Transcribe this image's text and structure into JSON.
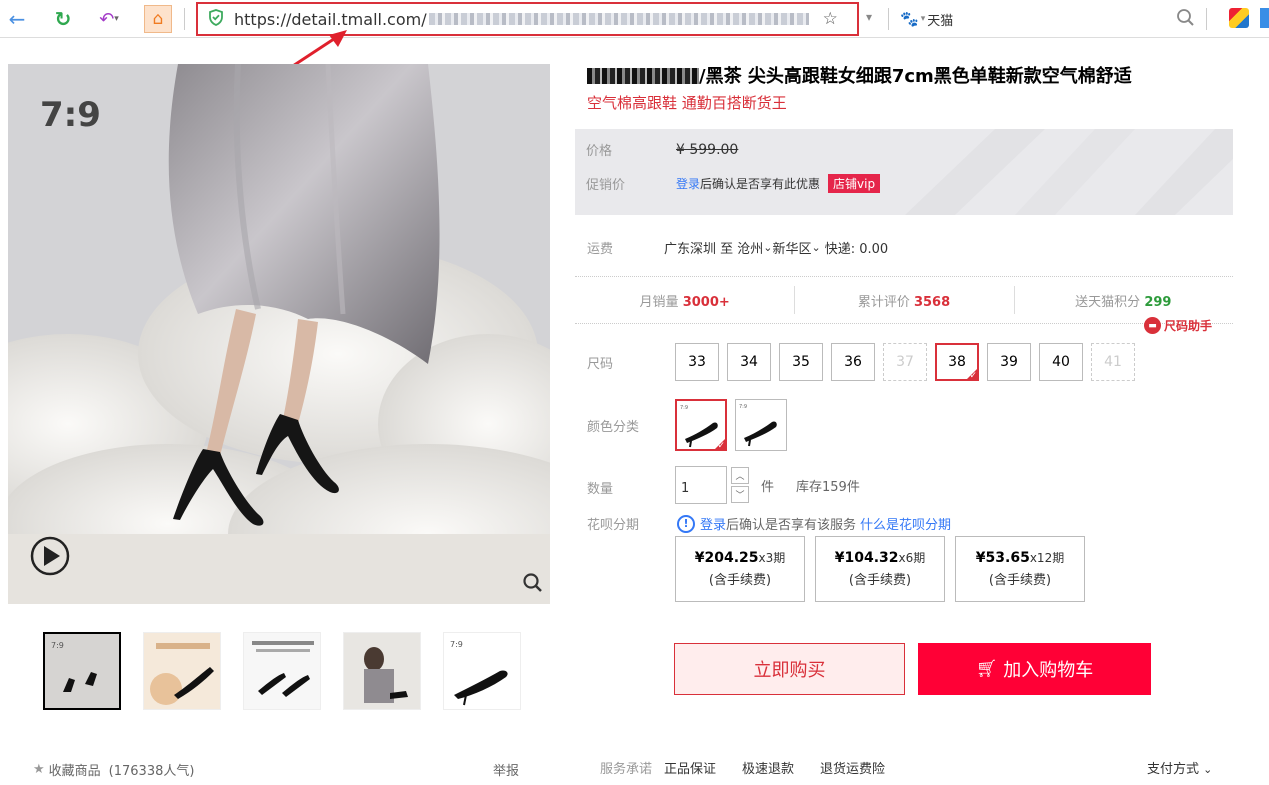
{
  "browser": {
    "url_prefix": "https://detail.tmall.com/",
    "search_text": "天猫"
  },
  "gallery": {
    "logo_text": "7:9",
    "thumbnails_count": 5
  },
  "product": {
    "title": "/黑茶 尖头高跟鞋女细跟7cm黑色单鞋新款空气棉舒适",
    "subtitle": "空气棉高跟鞋 通勤百搭断货王",
    "price_label": "价格",
    "price": "¥ 599.00",
    "promo_label": "促销价",
    "promo_text_link": "登录",
    "promo_text": "后确认是否享有此优惠",
    "vip_badge": "店铺vip",
    "shipping_label": "运费",
    "shipping_text": "广东深圳 至 沧州",
    "shipping_dest": "新华区",
    "shipping_fee": "快递: 0.00",
    "monthly_sales_label": "月销量",
    "monthly_sales": "3000+",
    "reviews_label": "累计评价",
    "reviews": "3568",
    "points_label": "送天猫积分",
    "points": "299",
    "size_helper": "尺码助手",
    "size_label": "尺码",
    "sizes": [
      "33",
      "34",
      "35",
      "36",
      "37",
      "38",
      "39",
      "40",
      "41"
    ],
    "selected_size": "38",
    "color_label": "颜色分类",
    "qty_label": "数量",
    "qty_value": "1",
    "qty_unit": "件",
    "stock": "库存159件",
    "huabei_label": "花呗分期",
    "huabei_login": "登录",
    "huabei_text": "后确认是否享有该服务",
    "huabei_link": "什么是花呗分期",
    "plans": [
      {
        "price": "¥204.25",
        "term": "x3期",
        "fee": "(含手续费)"
      },
      {
        "price": "¥104.32",
        "term": "x6期",
        "fee": "(含手续费)"
      },
      {
        "price": "¥53.65",
        "term": "x12期",
        "fee": "(含手续费)"
      }
    ],
    "buy_now": "立即购买",
    "add_cart": "加入购物车"
  },
  "footer": {
    "favorite": "收藏商品",
    "popularity": "(176338人气)",
    "report": "举报",
    "promise_label": "服务承诺",
    "promises": [
      "正品保证",
      "极速退款",
      "退货运费险"
    ],
    "pay": "支付方式"
  },
  "colors": {
    "accent": "#d9303a",
    "cart": "#ff0036",
    "link": "#3478f6"
  }
}
